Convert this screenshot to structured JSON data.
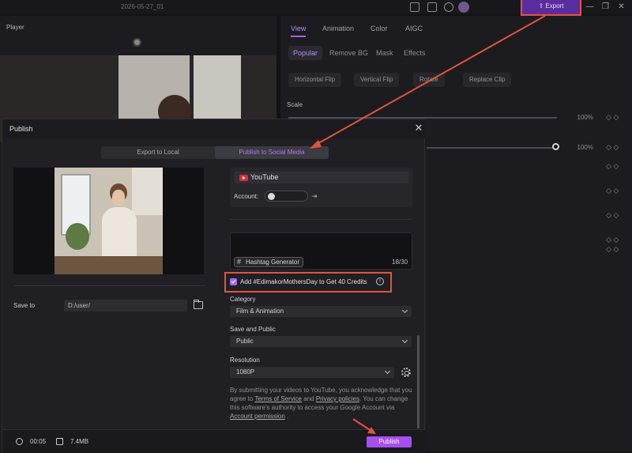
{
  "topbar": {
    "date": "2026-05-27_01",
    "export_label": "Export"
  },
  "player": {
    "title": "Player"
  },
  "right_panel": {
    "tabs": [
      {
        "label": "View",
        "active": true
      },
      {
        "label": "Animation"
      },
      {
        "label": "Color"
      },
      {
        "label": "AIGC"
      }
    ],
    "subtabs": [
      {
        "label": "Popular",
        "active": true
      },
      {
        "label": "Remove BG"
      },
      {
        "label": "Mask"
      },
      {
        "label": "Effects"
      }
    ],
    "transform_buttons": [
      "Horizontal Flip",
      "Vertical Flip",
      "Rotate",
      "Replace Clip"
    ],
    "scale_label": "Scale",
    "values": [
      "100%",
      "100%"
    ]
  },
  "dialog": {
    "title": "Publish",
    "modes": [
      {
        "label": "Export to Local"
      },
      {
        "label": "Publish to Social Media",
        "active": true
      }
    ],
    "save_to_label": "Save to",
    "save_to_path": "D:/user/",
    "platform": "YouTube",
    "account_label": "Account:",
    "hashtag_button": "Hashtag Generator",
    "char_count": "18/30",
    "promo_text": "Add #EdimakorMothersDay to Get 40 Credits",
    "promo_checked": true,
    "category_label": "Category",
    "category_value": "Film & Animation",
    "visibility_label": "Save and Public",
    "visibility_value": "Public",
    "resolution_label": "Resolution",
    "resolution_value": "1080P",
    "terms": {
      "part1": "By submitting your videos to YouTube, you acknowledge that you agree to ",
      "tos": "Terms of Service",
      "and": " and ",
      "privacy": "Privacy policies",
      "part2": ". You can change this software's authority to access your Google Account via ",
      "permission": "Account permission",
      "end": " ."
    },
    "duration": "00:05",
    "size": "7.4MB",
    "publish_label": "Publish"
  },
  "colors": {
    "accent": "#a64ff0",
    "annotation": "#e3533a"
  }
}
